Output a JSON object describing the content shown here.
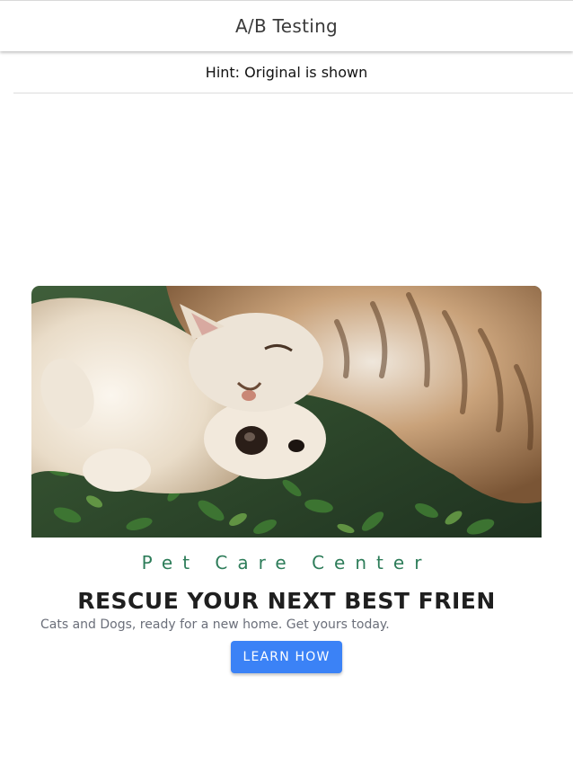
{
  "app_bar": {
    "title": "A/B Testing"
  },
  "hint": {
    "text": "Hint: Original is shown"
  },
  "hero": {
    "image_alt": "Cat and dog cuddling in grass",
    "brand": "Pet Care Center",
    "headline": "RESCUE YOUR NEXT BEST FRIEN",
    "subtext": "Cats and Dogs, ready for a new home. Get yours today.",
    "cta_label": "LEARN HOW"
  },
  "colors": {
    "brand_green": "#2e7d5a",
    "cta_blue": "#3b82f6",
    "headline": "#1f1f1f",
    "subtext": "#6b6f7a"
  }
}
